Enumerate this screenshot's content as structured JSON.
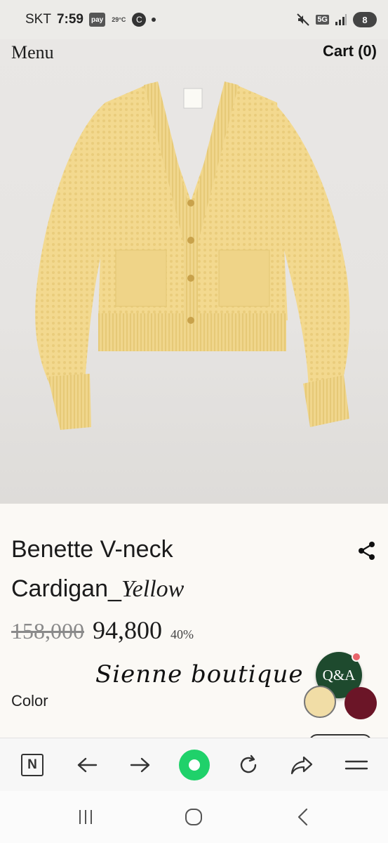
{
  "status_bar": {
    "carrier": "SKT",
    "time": "7:59",
    "pay_label": "pay",
    "temperature": "29°C",
    "c_badge": "C",
    "network": "5G",
    "battery": "8",
    "icons": [
      "mute-icon",
      "signal-icon",
      "battery-icon"
    ]
  },
  "header": {
    "menu_label": "Menu",
    "cart_label": "Cart (0)"
  },
  "product": {
    "title_line1": "Benette V-neck",
    "title_line2": "Cardigan_",
    "variant": "Yellow",
    "original_price": "158,000",
    "sale_price": "94,800",
    "discount": "40%",
    "image_description_icon": "cardigan-product-image"
  },
  "watermark": {
    "text": "Sienne boutique"
  },
  "qa_button": {
    "label": "Q&A",
    "color": "#1e4a2e",
    "badge_color": "#e8646a"
  },
  "color_options": {
    "label": "Color",
    "swatches": [
      {
        "name": "Yellow",
        "hex": "#f1dda6",
        "selected": true
      },
      {
        "name": "Burgundy",
        "hex": "#6b1527",
        "selected": false
      }
    ]
  },
  "browser_toolbar": {
    "items": [
      {
        "icon": "naver-icon",
        "label": "N"
      },
      {
        "icon": "back-arrow-icon"
      },
      {
        "icon": "forward-arrow-icon"
      },
      {
        "icon": "home-icon"
      },
      {
        "icon": "refresh-icon"
      },
      {
        "icon": "share-forward-icon"
      },
      {
        "icon": "menu-icon"
      }
    ],
    "home_color": "#1fd16a"
  },
  "android_nav": {
    "items": [
      {
        "icon": "recent-apps-icon"
      },
      {
        "icon": "home-circle-icon"
      },
      {
        "icon": "back-chevron-icon"
      }
    ]
  }
}
